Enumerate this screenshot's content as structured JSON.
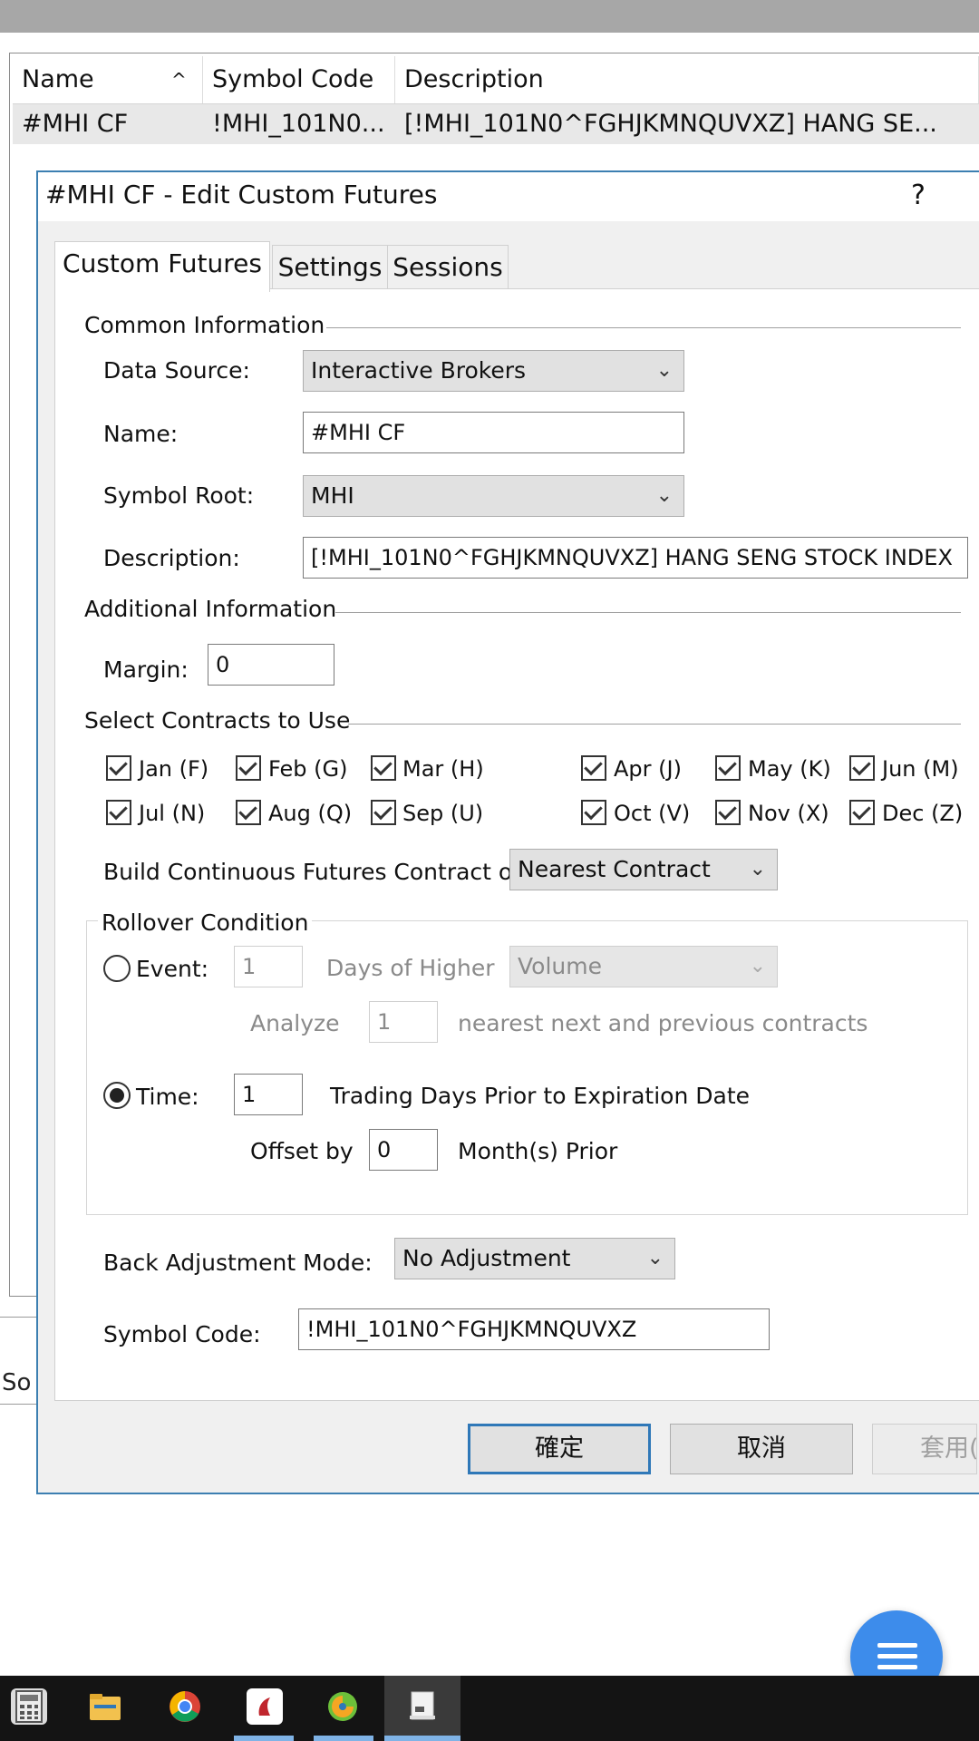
{
  "list": {
    "columns": [
      "Name",
      "Symbol Code",
      "Description"
    ],
    "sort_indicator": "^",
    "row": {
      "name": "#MHI CF",
      "symbol_code": "!MHI_101N0...",
      "description": "[!MHI_101N0^FGHJKMNQUVXZ] HANG SE..."
    },
    "status_fragment": "So"
  },
  "dialog": {
    "title": "#MHI CF - Edit Custom Futures",
    "help": "?",
    "tabs": [
      "Custom Futures",
      "Settings",
      "Sessions"
    ],
    "common_info": {
      "heading": "Common Information",
      "data_source_label": "Data Source:",
      "data_source_value": "Interactive Brokers",
      "name_label": "Name:",
      "name_value": "#MHI CF",
      "symbol_root_label": "Symbol Root:",
      "symbol_root_value": "MHI",
      "description_label": "Description:",
      "description_value": "[!MHI_101N0^FGHJKMNQUVXZ] HANG SENG STOCK INDEX"
    },
    "additional_info": {
      "heading": "Additional Information",
      "margin_label": "Margin:",
      "margin_value": "0"
    },
    "contracts": {
      "heading": "Select Contracts to Use",
      "months": [
        "Jan (F)",
        "Feb (G)",
        "Mar (H)",
        "Apr (J)",
        "May (K)",
        "Jun (M)",
        "Jul (N)",
        "Aug (Q)",
        "Sep (U)",
        "Oct (V)",
        "Nov (X)",
        "Dec (Z)"
      ]
    },
    "build_label": "Build Continuous Futures Contract on:",
    "build_value": "Nearest Contract",
    "rollover": {
      "heading": "Rollover Condition",
      "event_label": "Event:",
      "event_days": "1",
      "days_higher_label": "Days of Higher",
      "volume_value": "Volume",
      "analyze_label": "Analyze",
      "analyze_value": "1",
      "nearest_label": "nearest next and previous contracts",
      "time_label": "Time:",
      "time_value": "1",
      "trading_days_label": "Trading Days Prior to Expiration Date",
      "offset_label": "Offset by",
      "offset_value": "0",
      "months_prior_label": "Month(s) Prior"
    },
    "back_adj_label": "Back Adjustment Mode:",
    "back_adj_value": "No Adjustment",
    "symbol_code_label": "Symbol Code:",
    "symbol_code_value": "!MHI_101N0^FGHJKMNQUVXZ",
    "buttons": {
      "ok": "確定",
      "cancel": "取消",
      "apply": "套用("
    }
  },
  "colors": {
    "accent": "#2f78b8",
    "fab": "#3d8ceb",
    "taskbar": "#141414"
  }
}
